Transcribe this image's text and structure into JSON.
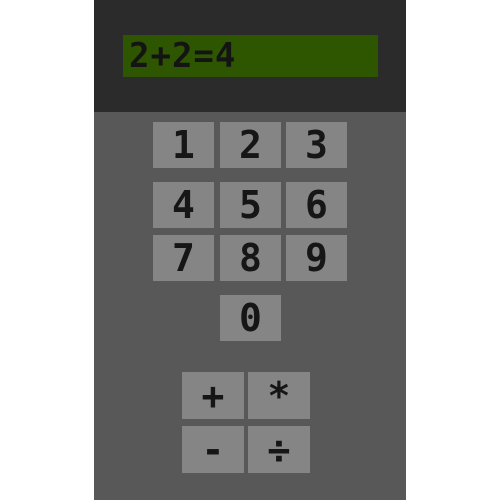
{
  "display": {
    "expression": "2+2=4"
  },
  "keypad": {
    "digits": [
      "1",
      "2",
      "3",
      "4",
      "5",
      "6",
      "7",
      "8",
      "9",
      "0"
    ],
    "operators": {
      "plus": "+",
      "multiply": "*",
      "minus": "-",
      "divide": "÷"
    }
  },
  "colors": {
    "body": "#585858",
    "display_frame": "#2b2b2b",
    "lcd_background": "#2e5600",
    "key_face": "#858585",
    "key_text": "#161616"
  }
}
